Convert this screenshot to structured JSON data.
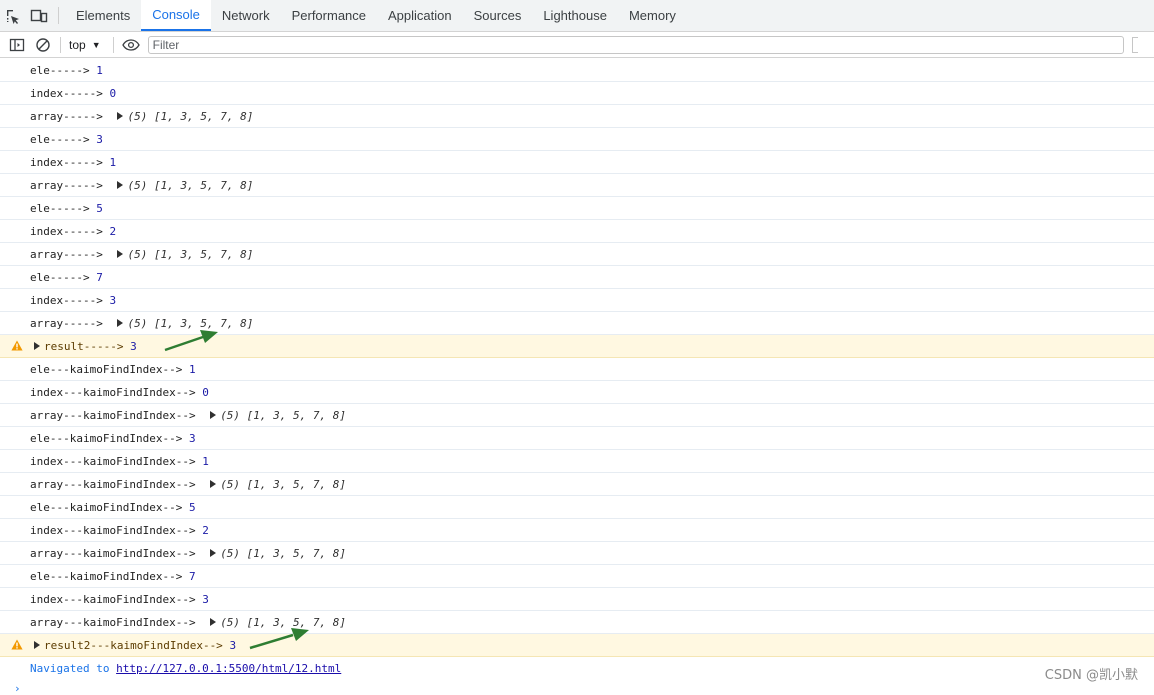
{
  "tabs": [
    {
      "label": "Elements",
      "active": false
    },
    {
      "label": "Console",
      "active": true
    },
    {
      "label": "Network",
      "active": false
    },
    {
      "label": "Performance",
      "active": false
    },
    {
      "label": "Application",
      "active": false
    },
    {
      "label": "Sources",
      "active": false
    },
    {
      "label": "Lighthouse",
      "active": false
    },
    {
      "label": "Memory",
      "active": false
    }
  ],
  "toolbar": {
    "context_label": "top",
    "filter_placeholder": "Filter",
    "icons": [
      "sidebar-toggle-icon",
      "clear-console-icon",
      "eye-icon"
    ]
  },
  "console": {
    "rows": [
      {
        "kind": "log",
        "label": "ele-----> ",
        "value": "1"
      },
      {
        "kind": "log",
        "label": "index-----> ",
        "value": "0"
      },
      {
        "kind": "arr",
        "label": "array-----> ",
        "array_text": "(5) [1, 3, 5, 7, 8]"
      },
      {
        "kind": "log",
        "label": "ele-----> ",
        "value": "3"
      },
      {
        "kind": "log",
        "label": "index-----> ",
        "value": "1"
      },
      {
        "kind": "arr",
        "label": "array-----> ",
        "array_text": "(5) [1, 3, 5, 7, 8]"
      },
      {
        "kind": "log",
        "label": "ele-----> ",
        "value": "5"
      },
      {
        "kind": "log",
        "label": "index-----> ",
        "value": "2"
      },
      {
        "kind": "arr",
        "label": "array-----> ",
        "array_text": "(5) [1, 3, 5, 7, 8]"
      },
      {
        "kind": "log",
        "label": "ele-----> ",
        "value": "7"
      },
      {
        "kind": "log",
        "label": "index-----> ",
        "value": "3"
      },
      {
        "kind": "arr",
        "label": "array-----> ",
        "array_text": "(5) [1, 3, 5, 7, 8]"
      },
      {
        "kind": "warn",
        "label": "result-----> ",
        "value": "3"
      },
      {
        "kind": "log",
        "label": "ele---kaimoFindIndex--> ",
        "value": "1"
      },
      {
        "kind": "log",
        "label": "index---kaimoFindIndex--> ",
        "value": "0"
      },
      {
        "kind": "arr",
        "label": "array---kaimoFindIndex--> ",
        "array_text": "(5) [1, 3, 5, 7, 8]"
      },
      {
        "kind": "log",
        "label": "ele---kaimoFindIndex--> ",
        "value": "3"
      },
      {
        "kind": "log",
        "label": "index---kaimoFindIndex--> ",
        "value": "1"
      },
      {
        "kind": "arr",
        "label": "array---kaimoFindIndex--> ",
        "array_text": "(5) [1, 3, 5, 7, 8]"
      },
      {
        "kind": "log",
        "label": "ele---kaimoFindIndex--> ",
        "value": "5"
      },
      {
        "kind": "log",
        "label": "index---kaimoFindIndex--> ",
        "value": "2"
      },
      {
        "kind": "arr",
        "label": "array---kaimoFindIndex--> ",
        "array_text": "(5) [1, 3, 5, 7, 8]"
      },
      {
        "kind": "log",
        "label": "ele---kaimoFindIndex--> ",
        "value": "7"
      },
      {
        "kind": "log",
        "label": "index---kaimoFindIndex--> ",
        "value": "3"
      },
      {
        "kind": "arr",
        "label": "array---kaimoFindIndex--> ",
        "array_text": "(5) [1, 3, 5, 7, 8]"
      },
      {
        "kind": "warn",
        "label": "result2---kaimoFindIndex--> ",
        "value": "3"
      },
      {
        "kind": "nav",
        "label": "Navigated to ",
        "link": "http://127.0.0.1:5500/html/12.html"
      }
    ],
    "prompt": "›"
  },
  "watermark": "CSDN @凯小默",
  "colors": {
    "accent": "#1a73e8",
    "warning_bg": "#fff8e1",
    "warning_icon": "#f29900",
    "annotation_arrow": "#2e7d32"
  }
}
